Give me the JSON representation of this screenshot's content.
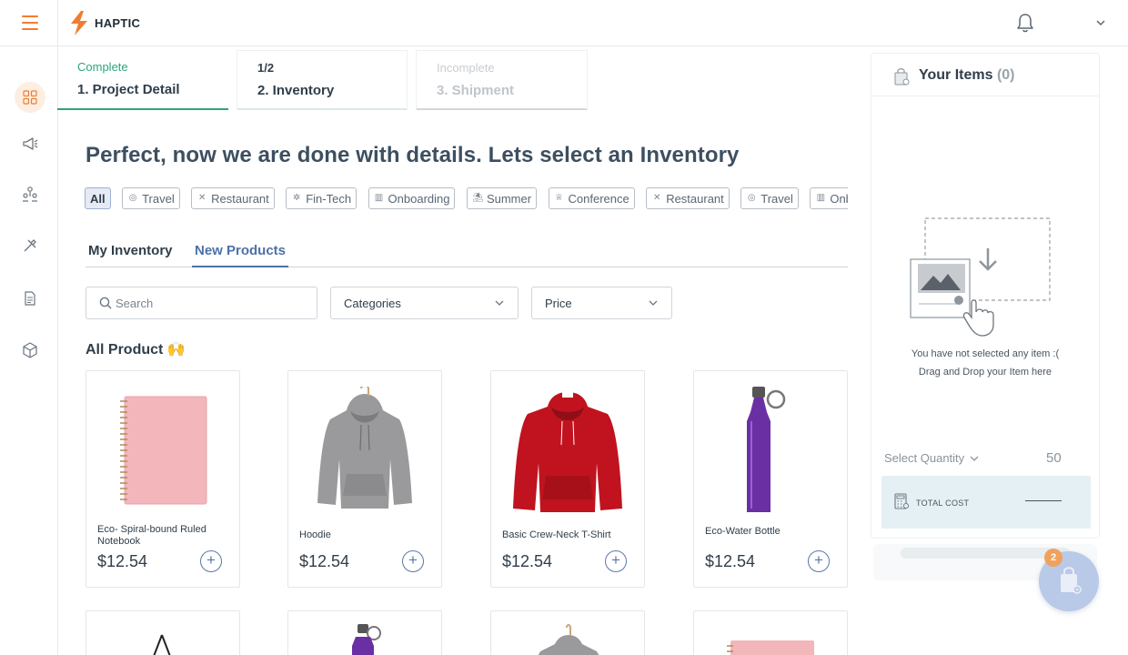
{
  "app": {
    "name": "HAPTIC"
  },
  "stepper": [
    {
      "status": "Complete",
      "title": "1. Project Detail"
    },
    {
      "status": "1/2",
      "title": "2. Inventory"
    },
    {
      "status": "Incomplete",
      "title": "3. Shipment"
    }
  ],
  "headline": "Perfect, now we are done with details. Lets select an Inventory",
  "chips": [
    {
      "label": "All",
      "icon": ""
    },
    {
      "label": "Travel",
      "icon": "compass-icon"
    },
    {
      "label": "Restaurant",
      "icon": "cutlery-icon"
    },
    {
      "label": "Fin-Tech",
      "icon": "gear-icon"
    },
    {
      "label": "Onboarding",
      "icon": "briefcase-icon"
    },
    {
      "label": "Summer",
      "icon": "umbrella-icon"
    },
    {
      "label": "Conference",
      "icon": "trophy-icon"
    },
    {
      "label": "Restaurant",
      "icon": "cutlery-icon"
    },
    {
      "label": "Travel",
      "icon": "compass-icon"
    },
    {
      "label": "Onboarding",
      "icon": "briefcase-icon"
    }
  ],
  "tabs": [
    "My Inventory",
    "New Products"
  ],
  "filters": {
    "search_placeholder": "Search",
    "categories": "Categories",
    "price": "Price"
  },
  "section_title": "All Product 🙌",
  "products": [
    {
      "name": "Eco- Spiral-bound Ruled Notebook",
      "price": "$12.54",
      "image": "notebook"
    },
    {
      "name": "Hoodie",
      "price": "$12.54",
      "image": "grey-hoodie"
    },
    {
      "name": "Basic Crew-Neck T-Shirt",
      "price": "$12.54",
      "image": "red-hoodie"
    },
    {
      "name": "Eco-Water Bottle",
      "price": "$12.54",
      "image": "bottle"
    }
  ],
  "cart": {
    "title": "Your Items",
    "count": "(0)",
    "empty_line1": "You have not selected any item :(",
    "empty_line2": "Drag and Drop your Item here",
    "qty_label": "Select Quantity",
    "qty_value": "50",
    "total_label": "TOTAL COST",
    "badge": "2"
  },
  "colors": {
    "accent": "#f07c32",
    "complete": "#2ba57a",
    "tab_active": "#4d71a8",
    "total_bg": "#e4f0f4"
  }
}
